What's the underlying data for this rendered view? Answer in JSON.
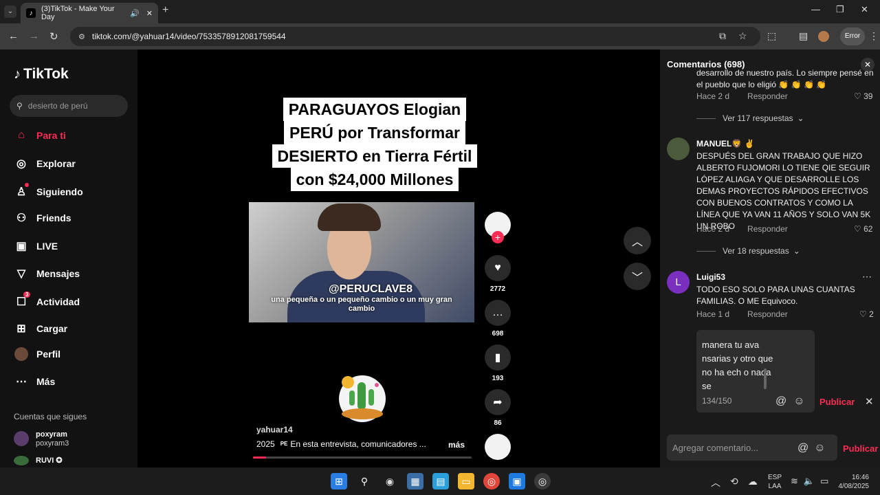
{
  "browser": {
    "tab_title": "(3)TikTok - Make Your Day",
    "url": "tiktok.com/@yahuar14/video/7533578912081759544",
    "profile_label": "Error"
  },
  "sidebar": {
    "logo_text": "TikTok",
    "search_placeholder": "desierto de perú",
    "nav": [
      {
        "label": "Para ti",
        "icon": "home-icon",
        "active": true
      },
      {
        "label": "Explorar",
        "icon": "compass-icon"
      },
      {
        "label": "Siguiendo",
        "icon": "following-icon"
      },
      {
        "label": "Friends",
        "icon": "friends-icon"
      },
      {
        "label": "LIVE",
        "icon": "live-icon"
      },
      {
        "label": "Mensajes",
        "icon": "send-icon"
      },
      {
        "label": "Actividad",
        "icon": "activity-icon",
        "badge": "3"
      },
      {
        "label": "Cargar",
        "icon": "upload-icon"
      },
      {
        "label": "Perfil",
        "icon": "avatar"
      },
      {
        "label": "Más",
        "icon": "more-icon"
      }
    ],
    "following_title": "Cuentas que sigues",
    "following": [
      {
        "name": "poxyram",
        "handle": "poxyram3"
      },
      {
        "name": "RUVI ✪",
        "handle": ""
      }
    ]
  },
  "video": {
    "title_lines": [
      "PARAGUAYOS Elogian",
      "PERÚ por Transformar",
      "DESIERTO en Tierra Fértil",
      "con $24,000 Millones"
    ],
    "watermark": "@PERUCLAVE8",
    "subtitle": "una pequeña o un pequeño cambio o un muy gran cambio",
    "username": "yahuar14",
    "year": "2025",
    "flag": "PE",
    "description": "En esta entrevista, comunicadores ...",
    "more": "más",
    "likes": "2772",
    "comments": "698",
    "saves": "193",
    "shares": "86",
    "progress_fraction": 0.06
  },
  "comments_panel": {
    "title": "Comentarios (698)",
    "items": [
      {
        "text": "desarrollo de nuestro país. Lo siempre pensé en el pueblo que lo eligió 👏 👏 👏 👏",
        "time": "Hace 2 d",
        "reply": "Responder",
        "likes": "39",
        "replies": "Ver 117 respuestas"
      },
      {
        "author": "MANUEL🦁 ✌",
        "text": "DESPUÉS DEL GRAN TRABAJO QUE HIZO ALBERTO FUJOMORI LO TIENE QIE SEGUIR LÓPEZ ALIAGA Y QUE DESARROLLE LOS DEMAS PROYECTOS RÁPIDOS EFECTIVOS CON BUENOS CONTRATOS Y COMO LA LÍNEA QUE YA VAN 11 AÑOS Y SOLO VAN 5K UN ROBO",
        "time": "Hace 2 d",
        "reply": "Responder",
        "likes": "62",
        "replies": "Ver 18 respuestas"
      },
      {
        "author": "Luigi53",
        "avatar_letter": "L",
        "text": "TODO ESO SOLO PARA UNAS CUANTAS FAMILIAS. O ME Equivoco.",
        "time": "Hace 1 d",
        "reply": "Responder",
        "likes": "2"
      }
    ],
    "draft_text": "manera tu ava nsarias y otro que no ha ech o nada se",
    "draft_count": "134/150",
    "post_label": "Publicar",
    "add_placeholder": "Agregar comentario..."
  },
  "taskbar": {
    "lang": "ESP",
    "lang2": "LAA",
    "time": "16:46",
    "date": "4/08/2025"
  }
}
